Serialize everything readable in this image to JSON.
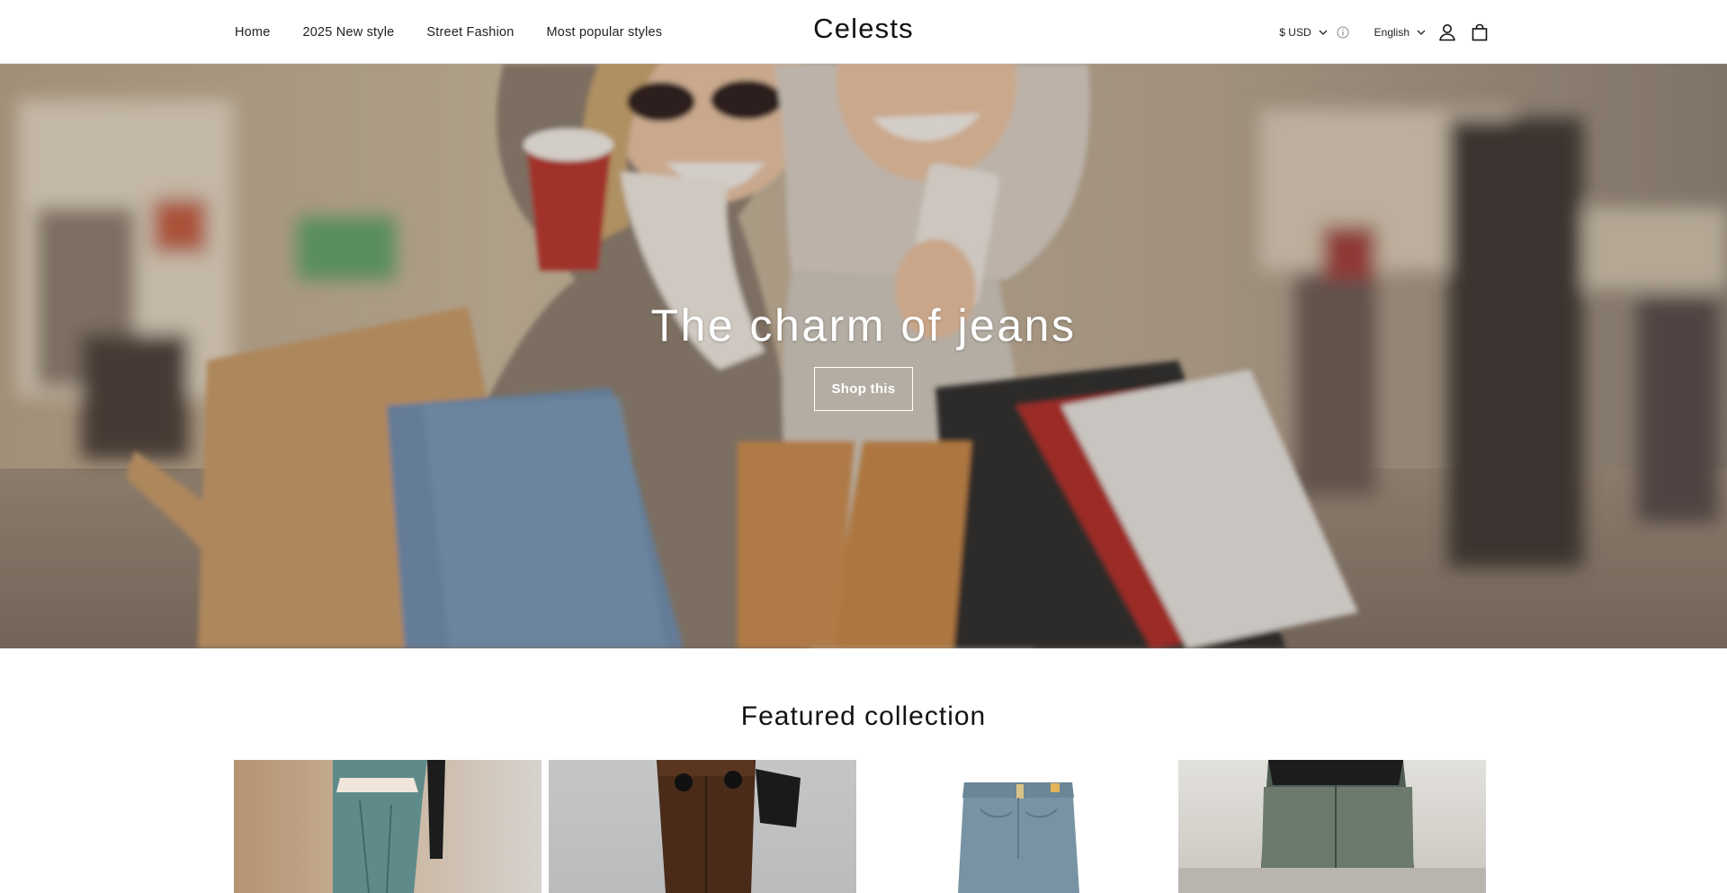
{
  "header": {
    "nav": [
      "Home",
      "2025 New style",
      "Street Fashion",
      "Most popular styles"
    ],
    "logo": "Celests",
    "currency": "$ USD",
    "language": "English",
    "icons": [
      "chevron-down-icon",
      "info-icon",
      "account-icon",
      "cart-icon"
    ]
  },
  "hero": {
    "title": "The charm of jeans",
    "button_label": "Shop this"
  },
  "featured": {
    "title": "Featured collection",
    "products": [
      {
        "image": "woman in cut-out blue jeans"
      },
      {
        "image": "woman in brown jeans with black bag"
      },
      {
        "image": "light blue jeans product shot"
      },
      {
        "image": "woman in faded green-blue jeans"
      }
    ]
  },
  "colors": {
    "text": "#121212",
    "background": "#ffffff",
    "hero_button_border": "#ffffff"
  }
}
